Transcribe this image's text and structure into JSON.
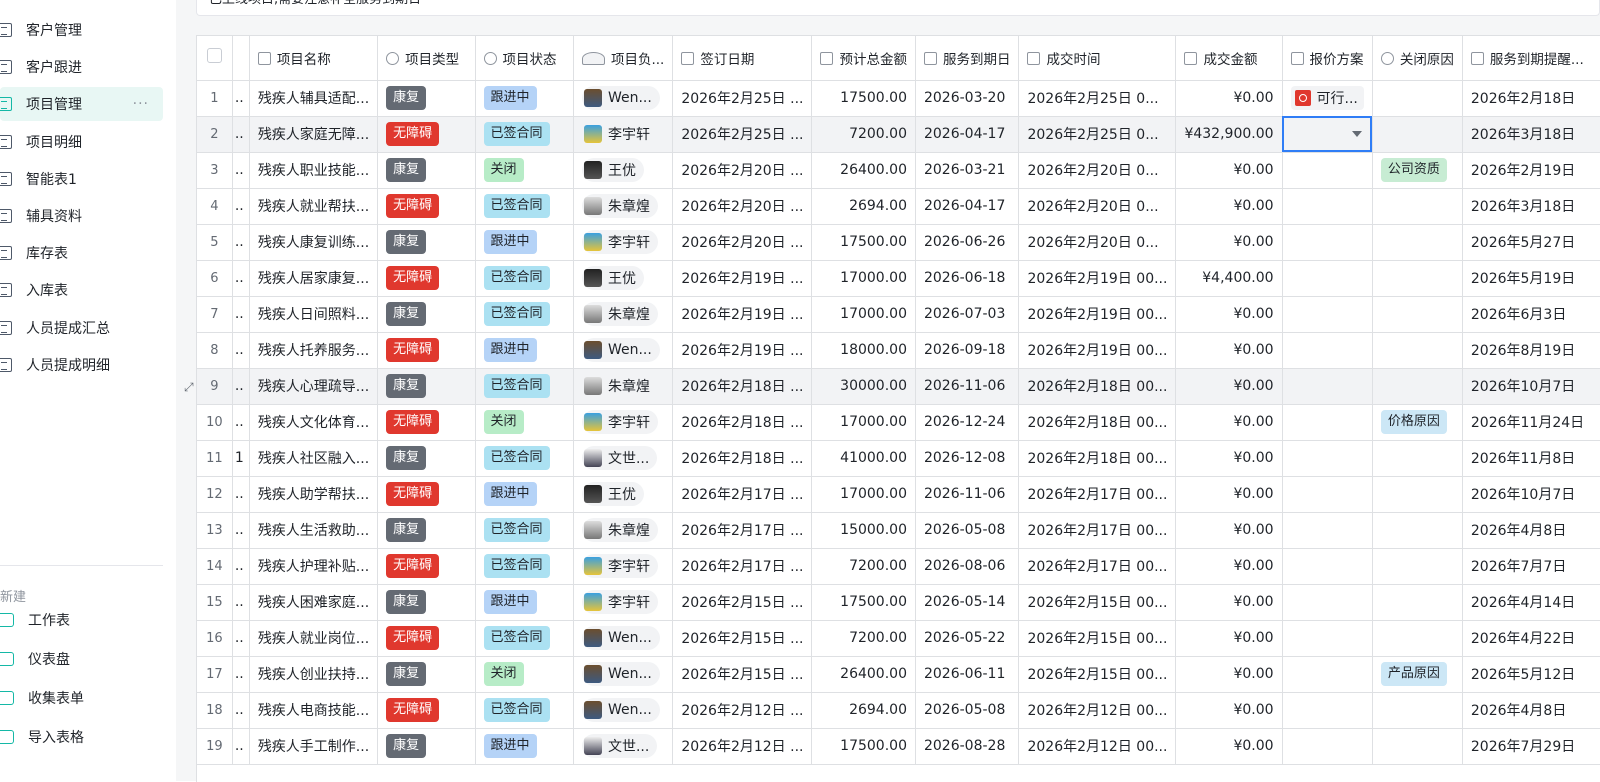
{
  "sidebar": {
    "items": [
      {
        "label": "客户管理",
        "active": false
      },
      {
        "label": "客户跟进",
        "active": false
      },
      {
        "label": "项目管理",
        "active": true
      },
      {
        "label": "项目明细",
        "active": false
      },
      {
        "label": "智能表1",
        "active": false
      },
      {
        "label": "辅具资料",
        "active": false
      },
      {
        "label": "库存表",
        "active": false
      },
      {
        "label": "入库表",
        "active": false
      },
      {
        "label": "人员提成汇总",
        "active": false
      },
      {
        "label": "人员提成明细",
        "active": false
      }
    ],
    "more_glyph": "···",
    "new_label": "新建",
    "create_items": [
      {
        "label": "工作表",
        "icon": "add-sheet-icon"
      },
      {
        "label": "仪表盘",
        "icon": "dashboard-icon"
      },
      {
        "label": "收集表单",
        "icon": "form-icon"
      },
      {
        "label": "导入表格",
        "icon": "import-icon"
      }
    ]
  },
  "description": "已上线项目,需要注意补全服务到期日",
  "table": {
    "headers": [
      "项目名称",
      "项目类型",
      "项目状态",
      "项目负...",
      "签订日期",
      "预计总金额",
      "服务到期日",
      "成交时间",
      "成交金额",
      "报价方案",
      "关闭原因",
      "服务到期提醒..."
    ],
    "rows": [
      {
        "no": "1",
        "prefix": "..",
        "name": "残疾人辅具适配...",
        "type": "康复",
        "status": "跟进中",
        "owner": "Wen...",
        "owner_av": "w",
        "sign": "2026年2月25日 ...",
        "est": "17500.00",
        "due": "2026-03-20",
        "deal": "2026年2月25日 0...",
        "amount": "¥0.00",
        "plan": "可行...",
        "reason": "",
        "remind": "2026年2月18日"
      },
      {
        "no": "2",
        "prefix": "..",
        "name": "残疾人家庭无障...",
        "type": "无障碍",
        "status": "已签合同",
        "owner": "李宇轩",
        "owner_av": "l",
        "sign": "2026年2月25日 ...",
        "est": "7200.00",
        "due": "2026-04-17",
        "deal": "2026年2月25日 0...",
        "amount": "¥432,900.00",
        "plan": "",
        "reason": "",
        "remind": "2026年3月18日"
      },
      {
        "no": "3",
        "prefix": "..",
        "name": "残疾人职业技能...",
        "type": "康复",
        "status": "关闭",
        "owner": "王优",
        "owner_av": "y",
        "sign": "2026年2月20日 ...",
        "est": "26400.00",
        "due": "2026-03-21",
        "deal": "2026年2月20日 0...",
        "amount": "¥0.00",
        "plan": "",
        "reason": "公司资质",
        "remind": "2026年2月19日"
      },
      {
        "no": "4",
        "prefix": "..",
        "name": "残疾人就业帮扶...",
        "type": "无障碍",
        "status": "已签合同",
        "owner": "朱章煌",
        "owner_av": "z",
        "sign": "2026年2月20日 ...",
        "est": "2694.00",
        "due": "2026-04-17",
        "deal": "2026年2月20日 0...",
        "amount": "¥0.00",
        "plan": "",
        "reason": "",
        "remind": "2026年3月18日"
      },
      {
        "no": "5",
        "prefix": "..",
        "name": "残疾人康复训练...",
        "type": "康复",
        "status": "跟进中",
        "owner": "李宇轩",
        "owner_av": "l",
        "sign": "2026年2月20日 ...",
        "est": "17500.00",
        "due": "2026-06-26",
        "deal": "2026年2月20日 0...",
        "amount": "¥0.00",
        "plan": "",
        "reason": "",
        "remind": "2026年5月27日"
      },
      {
        "no": "6",
        "prefix": "..",
        "name": "残疾人居家康复...",
        "type": "无障碍",
        "status": "已签合同",
        "owner": "王优",
        "owner_av": "y",
        "sign": "2026年2月19日 ...",
        "est": "17000.00",
        "due": "2026-06-18",
        "deal": "2026年2月19日 00...",
        "amount": "¥4,400.00",
        "plan": "",
        "reason": "",
        "remind": "2026年5月19日"
      },
      {
        "no": "7",
        "prefix": "..",
        "name": "残疾人日间照料...",
        "type": "康复",
        "status": "已签合同",
        "owner": "朱章煌",
        "owner_av": "z",
        "sign": "2026年2月19日 ...",
        "est": "17000.00",
        "due": "2026-07-03",
        "deal": "2026年2月19日 00...",
        "amount": "¥0.00",
        "plan": "",
        "reason": "",
        "remind": "2026年6月3日"
      },
      {
        "no": "8",
        "prefix": "..",
        "name": "残疾人托养服务...",
        "type": "无障碍",
        "status": "跟进中",
        "owner": "Wen...",
        "owner_av": "w",
        "sign": "2026年2月19日 ...",
        "est": "18000.00",
        "due": "2026-09-18",
        "deal": "2026年2月19日 00...",
        "amount": "¥0.00",
        "plan": "",
        "reason": "",
        "remind": "2026年8月19日"
      },
      {
        "no": "9",
        "prefix": "..",
        "name": "残疾人心理疏导...",
        "type": "康复",
        "status": "已签合同",
        "owner": "朱章煌",
        "owner_av": "z",
        "sign": "2026年2月18日 ...",
        "est": "30000.00",
        "due": "2026-11-06",
        "deal": "2026年2月18日 00...",
        "amount": "¥0.00",
        "plan": "",
        "reason": "",
        "remind": "2026年10月7日"
      },
      {
        "no": "10",
        "prefix": "..",
        "name": "残疾人文化体育...",
        "type": "无障碍",
        "status": "关闭",
        "owner": "李宇轩",
        "owner_av": "l",
        "sign": "2026年2月18日 ...",
        "est": "17000.00",
        "due": "2026-12-24",
        "deal": "2026年2月18日 00...",
        "amount": "¥0.00",
        "plan": "",
        "reason": "价格原因",
        "remind": "2026年11月24日"
      },
      {
        "no": "11",
        "prefix": "1",
        "name": "残疾人社区融入...",
        "type": "康复",
        "status": "已签合同",
        "owner": "文世...",
        "owner_av": "s",
        "sign": "2026年2月18日 ...",
        "est": "41000.00",
        "due": "2026-12-08",
        "deal": "2026年2月18日 00...",
        "amount": "¥0.00",
        "plan": "",
        "reason": "",
        "remind": "2026年11月8日"
      },
      {
        "no": "12",
        "prefix": "..",
        "name": "残疾人助学帮扶...",
        "type": "无障碍",
        "status": "跟进中",
        "owner": "王优",
        "owner_av": "y",
        "sign": "2026年2月17日 ...",
        "est": "17000.00",
        "due": "2026-11-06",
        "deal": "2026年2月17日 00...",
        "amount": "¥0.00",
        "plan": "",
        "reason": "",
        "remind": "2026年10月7日"
      },
      {
        "no": "13",
        "prefix": "..",
        "name": "残疾人生活救助...",
        "type": "康复",
        "status": "已签合同",
        "owner": "朱章煌",
        "owner_av": "z",
        "sign": "2026年2月17日 ...",
        "est": "15000.00",
        "due": "2026-05-08",
        "deal": "2026年2月17日 00...",
        "amount": "¥0.00",
        "plan": "",
        "reason": "",
        "remind": "2026年4月8日"
      },
      {
        "no": "14",
        "prefix": "..",
        "name": "残疾人护理补贴...",
        "type": "无障碍",
        "status": "已签合同",
        "owner": "李宇轩",
        "owner_av": "l",
        "sign": "2026年2月17日 ...",
        "est": "7200.00",
        "due": "2026-08-06",
        "deal": "2026年2月17日 00...",
        "amount": "¥0.00",
        "plan": "",
        "reason": "",
        "remind": "2026年7月7日"
      },
      {
        "no": "15",
        "prefix": "..",
        "name": "残疾人困难家庭...",
        "type": "康复",
        "status": "跟进中",
        "owner": "李宇轩",
        "owner_av": "l",
        "sign": "2026年2月15日 ...",
        "est": "17500.00",
        "due": "2026-05-14",
        "deal": "2026年2月15日 00...",
        "amount": "¥0.00",
        "plan": "",
        "reason": "",
        "remind": "2026年4月14日"
      },
      {
        "no": "16",
        "prefix": "..",
        "name": "残疾人就业岗位...",
        "type": "无障碍",
        "status": "已签合同",
        "owner": "Wen...",
        "owner_av": "w",
        "sign": "2026年2月15日 ...",
        "est": "7200.00",
        "due": "2026-05-22",
        "deal": "2026年2月15日 00...",
        "amount": "¥0.00",
        "plan": "",
        "reason": "",
        "remind": "2026年4月22日"
      },
      {
        "no": "17",
        "prefix": "..",
        "name": "残疾人创业扶持...",
        "type": "康复",
        "status": "关闭",
        "owner": "Wen...",
        "owner_av": "w",
        "sign": "2026年2月15日 ...",
        "est": "26400.00",
        "due": "2026-06-11",
        "deal": "2026年2月15日 00...",
        "amount": "¥0.00",
        "plan": "",
        "reason": "产品原因",
        "remind": "2026年5月12日"
      },
      {
        "no": "18",
        "prefix": "..",
        "name": "残疾人电商技能...",
        "type": "无障碍",
        "status": "已签合同",
        "owner": "Wen...",
        "owner_av": "w",
        "sign": "2026年2月12日 ...",
        "est": "2694.00",
        "due": "2026-05-08",
        "deal": "2026年2月12日 00...",
        "amount": "¥0.00",
        "plan": "",
        "reason": "",
        "remind": "2026年4月8日"
      },
      {
        "no": "19",
        "prefix": "..",
        "name": "残疾人手工制作...",
        "type": "康复",
        "status": "跟进中",
        "owner": "文世...",
        "owner_av": "s",
        "sign": "2026年2月12日 ...",
        "est": "17500.00",
        "due": "2026-08-28",
        "deal": "2026年2月12日 00...",
        "amount": "¥0.00",
        "plan": "",
        "reason": "",
        "remind": "2026年7月29日"
      }
    ]
  },
  "colors": {
    "accent": "#14b8a6",
    "tag_kangfu": "#646a73",
    "tag_wuzhangai": "#e0382e",
    "status_followup": "#b5d3f7",
    "status_signed": "#abe1f2",
    "status_closed": "#b7ecc7",
    "selection": "#2f7df6"
  }
}
